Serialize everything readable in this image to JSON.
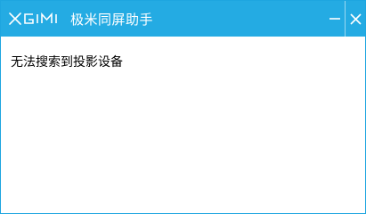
{
  "window": {
    "logo_text": "XGIMI",
    "title": "极米同屏助手",
    "accent_color": "#24abe3"
  },
  "controls": {
    "minimize_icon": "minimize-icon",
    "close_icon": "close-icon"
  },
  "content": {
    "message": "无法搜索到投影设备"
  }
}
